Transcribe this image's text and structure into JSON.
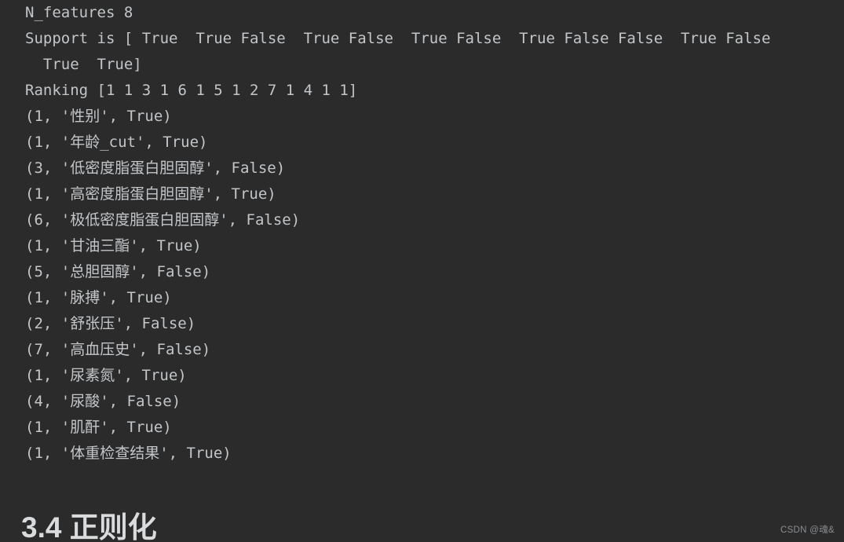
{
  "theme": {
    "background": "#2b2b2b",
    "text": "#c3c6c9",
    "heading": "#d9dbdd",
    "watermark": "#8a8d90"
  },
  "output": {
    "lines": [
      "N_features 8",
      "Support is [ True  True False  True False  True False  True False False  True False",
      "  True  True]",
      "Ranking [1 1 3 1 6 1 5 1 2 7 1 4 1 1]",
      "(1, '性别', True)",
      "(1, '年龄_cut', True)",
      "(3, '低密度脂蛋白胆固醇', False)",
      "(1, '高密度脂蛋白胆固醇', True)",
      "(6, '极低密度脂蛋白胆固醇', False)",
      "(1, '甘油三酯', True)",
      "(5, '总胆固醇', False)",
      "(1, '脉搏', True)",
      "(2, '舒张压', False)",
      "(7, '高血压史', False)",
      "(1, '尿素氮', True)",
      "(4, '尿酸', False)",
      "(1, '肌酐', True)",
      "(1, '体重检查结果', True)"
    ],
    "n_features_label": "N_features",
    "n_features_value": "8",
    "support_label": "Support is",
    "support_values": [
      "True",
      "True",
      "False",
      "True",
      "False",
      "True",
      "False",
      "True",
      "False",
      "False",
      "True",
      "False",
      "True",
      "True"
    ],
    "ranking_label": "Ranking",
    "ranking_values": [
      1,
      1,
      3,
      1,
      6,
      1,
      5,
      1,
      2,
      7,
      1,
      4,
      1,
      1
    ],
    "feature_tuples": [
      {
        "rank": 1,
        "name": "性别",
        "selected": "True"
      },
      {
        "rank": 1,
        "name": "年龄_cut",
        "selected": "True"
      },
      {
        "rank": 3,
        "name": "低密度脂蛋白胆固醇",
        "selected": "False"
      },
      {
        "rank": 1,
        "name": "高密度脂蛋白胆固醇",
        "selected": "True"
      },
      {
        "rank": 6,
        "name": "极低密度脂蛋白胆固醇",
        "selected": "False"
      },
      {
        "rank": 1,
        "name": "甘油三酯",
        "selected": "True"
      },
      {
        "rank": 5,
        "name": "总胆固醇",
        "selected": "False"
      },
      {
        "rank": 1,
        "name": "脉搏",
        "selected": "True"
      },
      {
        "rank": 2,
        "name": "舒张压",
        "selected": "False"
      },
      {
        "rank": 7,
        "name": "高血压史",
        "selected": "False"
      },
      {
        "rank": 1,
        "name": "尿素氮",
        "selected": "True"
      },
      {
        "rank": 4,
        "name": "尿酸",
        "selected": "False"
      },
      {
        "rank": 1,
        "name": "肌酐",
        "selected": "True"
      },
      {
        "rank": 1,
        "name": "体重检查结果",
        "selected": "True"
      }
    ]
  },
  "heading": {
    "text": "3.4 正则化"
  },
  "watermark": {
    "text": "CSDN @魂&"
  }
}
